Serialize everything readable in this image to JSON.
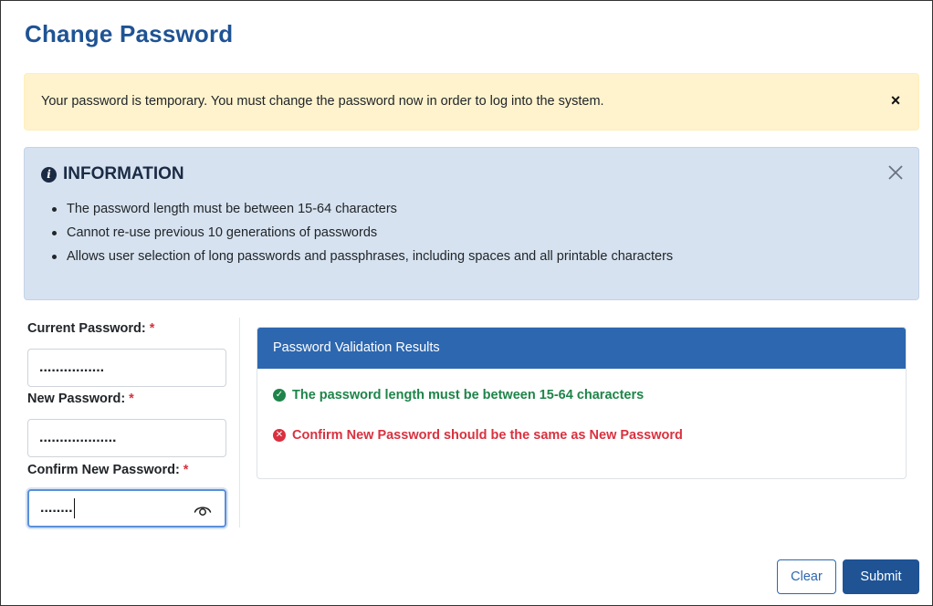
{
  "page": {
    "title": "Change Password"
  },
  "warning": {
    "text": "Your password is temporary. You must change the password now in order to log into the system.",
    "close_label": "×"
  },
  "information": {
    "title": "INFORMATION",
    "icon": "info-circle-icon",
    "items": [
      "The password length must be between 15-64 characters",
      "Cannot re-use previous 10 generations of passwords",
      "Allows user selection of long passwords and passphrases, including spaces and all printable characters"
    ]
  },
  "form": {
    "current_password": {
      "label": "Current Password:",
      "value": "................"
    },
    "new_password": {
      "label": "New Password:",
      "value": "..................."
    },
    "confirm_password": {
      "label": "Confirm New Password:",
      "value": "........"
    },
    "required_mark": "*"
  },
  "validation": {
    "header": "Password Validation Results",
    "results": [
      {
        "status": "pass",
        "text": "The password length must be between 15-64 characters",
        "color": "#1e8449"
      },
      {
        "status": "fail",
        "text": "Confirm New Password should be the same as New Password",
        "color": "#d9313f"
      }
    ]
  },
  "buttons": {
    "clear": "Clear",
    "submit": "Submit"
  },
  "colors": {
    "title": "#1f5394",
    "panel_header": "#2d67b0",
    "warning_bg": "#fff3cd",
    "info_bg": "#d6e2f0",
    "required": "#d9313f"
  }
}
